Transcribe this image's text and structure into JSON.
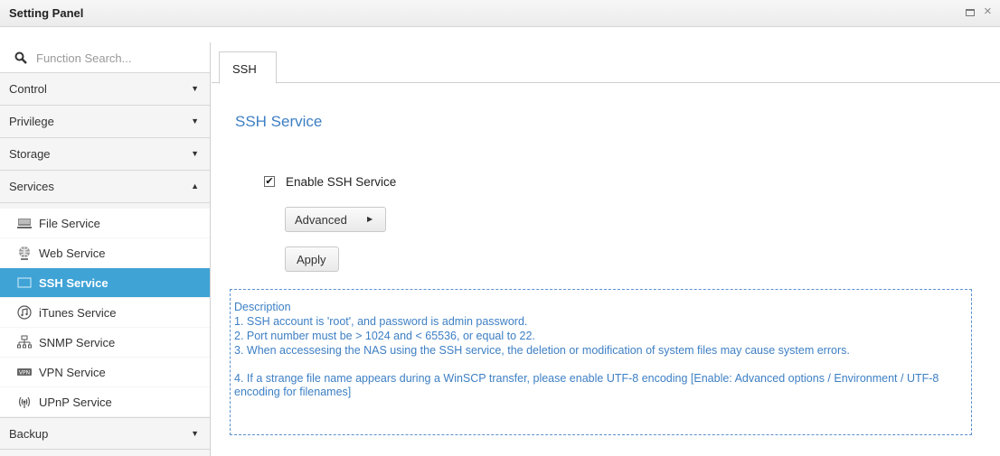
{
  "window": {
    "title": "Setting Panel"
  },
  "sidebar": {
    "search_placeholder": "Function Search...",
    "categories": [
      {
        "label": "Control",
        "expanded": false
      },
      {
        "label": "Privilege",
        "expanded": false
      },
      {
        "label": "Storage",
        "expanded": false
      },
      {
        "label": "Services",
        "expanded": true
      },
      {
        "label": "Backup",
        "expanded": false
      }
    ],
    "services_items": [
      {
        "label": "File Service",
        "icon": "file-service-icon"
      },
      {
        "label": "Web Service",
        "icon": "web-service-icon"
      },
      {
        "label": "SSH Service",
        "icon": "ssh-service-icon",
        "active": true
      },
      {
        "label": "iTunes Service",
        "icon": "itunes-icon"
      },
      {
        "label": "SNMP Service",
        "icon": "snmp-icon"
      },
      {
        "label": "VPN Service",
        "icon": "vpn-icon"
      },
      {
        "label": "UPnP Service",
        "icon": "upnp-icon"
      }
    ],
    "collapsed_arrow": "▼",
    "expanded_arrow": "▲"
  },
  "main": {
    "tab": "SSH",
    "section_title": "SSH Service",
    "enable_label": "Enable SSH Service",
    "enable_checked": true,
    "advanced_label": "Advanced",
    "apply_label": "Apply",
    "description": {
      "heading": "Description",
      "lines": [
        "1. SSH account is 'root', and password is admin password.",
        "2. Port number must be > 1024 and < 65536, or equal to 22.",
        "3. When accessesing the NAS using the SSH service, the deletion or modification of system files may cause system errors.",
        "4. If a strange file name appears during a WinSCP transfer, please enable UTF-8 encoding [Enable: Advanced options / Environment / UTF-8 encoding for filenames]"
      ]
    }
  },
  "colors": {
    "accent": "#3fa3d6",
    "link_blue": "#3d7fc4"
  }
}
